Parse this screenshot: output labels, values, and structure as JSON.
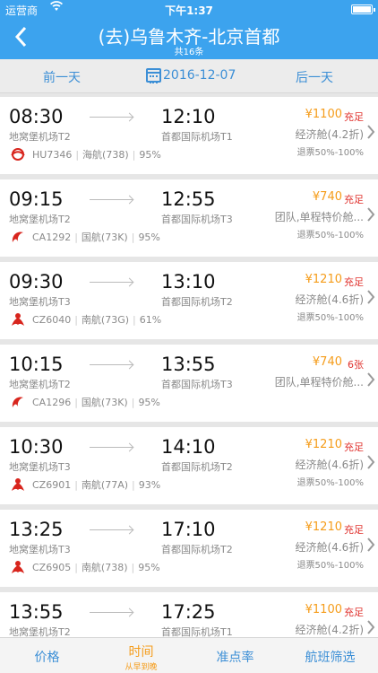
{
  "status": {
    "carrier": "运营商",
    "time": "下午1:37"
  },
  "nav": {
    "back_icon": "chevron-left-icon",
    "title": "(去)乌鲁木齐-北京首都",
    "subtitle": "共16条"
  },
  "datebar": {
    "prev": "前一天",
    "date": "2016-12-07",
    "next": "后一天"
  },
  "flights": [
    {
      "dep_time": "08:30",
      "arr_time": "12:10",
      "dep_airport": "地窝堡机场T2",
      "arr_airport": "首都国际机场T1",
      "flight_no": "HU7346",
      "airline_model": "海航(738)",
      "on_time": "95%",
      "price": "¥1100",
      "avail": "充足",
      "cabin": "经济舱(4.2折)",
      "refund": "退票50%-100%",
      "logo": "hainan-airlines-logo"
    },
    {
      "dep_time": "09:15",
      "arr_time": "12:55",
      "dep_airport": "地窝堡机场T2",
      "arr_airport": "首都国际机场T3",
      "flight_no": "CA1292",
      "airline_model": "国航(73K)",
      "on_time": "95%",
      "price": "¥740",
      "avail": "充足",
      "cabin": "团队,单程特价舱...",
      "refund": "退票50%-100%",
      "logo": "air-china-logo"
    },
    {
      "dep_time": "09:30",
      "arr_time": "13:10",
      "dep_airport": "地窝堡机场T3",
      "arr_airport": "首都国际机场T2",
      "flight_no": "CZ6040",
      "airline_model": "南航(73G)",
      "on_time": "61%",
      "price": "¥1210",
      "avail": "充足",
      "cabin": "经济舱(4.6折)",
      "refund": "退票50%-100%",
      "logo": "china-southern-logo"
    },
    {
      "dep_time": "10:15",
      "arr_time": "13:55",
      "dep_airport": "地窝堡机场T2",
      "arr_airport": "首都国际机场T3",
      "flight_no": "CA1296",
      "airline_model": "国航(73K)",
      "on_time": "95%",
      "price": "¥740",
      "avail": "6张",
      "cabin": "团队,单程特价舱...",
      "refund": "",
      "logo": "air-china-logo"
    },
    {
      "dep_time": "10:30",
      "arr_time": "14:10",
      "dep_airport": "地窝堡机场T3",
      "arr_airport": "首都国际机场T2",
      "flight_no": "CZ6901",
      "airline_model": "南航(77A)",
      "on_time": "93%",
      "price": "¥1210",
      "avail": "充足",
      "cabin": "经济舱(4.6折)",
      "refund": "退票50%-100%",
      "logo": "china-southern-logo"
    },
    {
      "dep_time": "13:25",
      "arr_time": "17:10",
      "dep_airport": "地窝堡机场T3",
      "arr_airport": "首都国际机场T2",
      "flight_no": "CZ6905",
      "airline_model": "南航(738)",
      "on_time": "95%",
      "price": "¥1210",
      "avail": "充足",
      "cabin": "经济舱(4.6折)",
      "refund": "退票50%-100%",
      "logo": "china-southern-logo"
    },
    {
      "dep_time": "13:55",
      "arr_time": "17:25",
      "dep_airport": "地窝堡机场T2",
      "arr_airport": "首都国际机场T1",
      "flight_no": "",
      "airline_model": "",
      "on_time": "",
      "price": "¥1100",
      "avail": "充足",
      "cabin": "经济舱(4.2折)",
      "refund": "",
      "logo": "hainan-airlines-logo"
    }
  ],
  "tabs": [
    {
      "label": "价格",
      "sub": ""
    },
    {
      "label": "时间",
      "sub": "从早到晚"
    },
    {
      "label": "准点率",
      "sub": ""
    },
    {
      "label": "航班筛选",
      "sub": ""
    }
  ],
  "colors": {
    "primary": "#3ca3ee",
    "accent": "#f59c1a",
    "alert": "#e0322e",
    "text_secondary": "#8a8a8a"
  }
}
